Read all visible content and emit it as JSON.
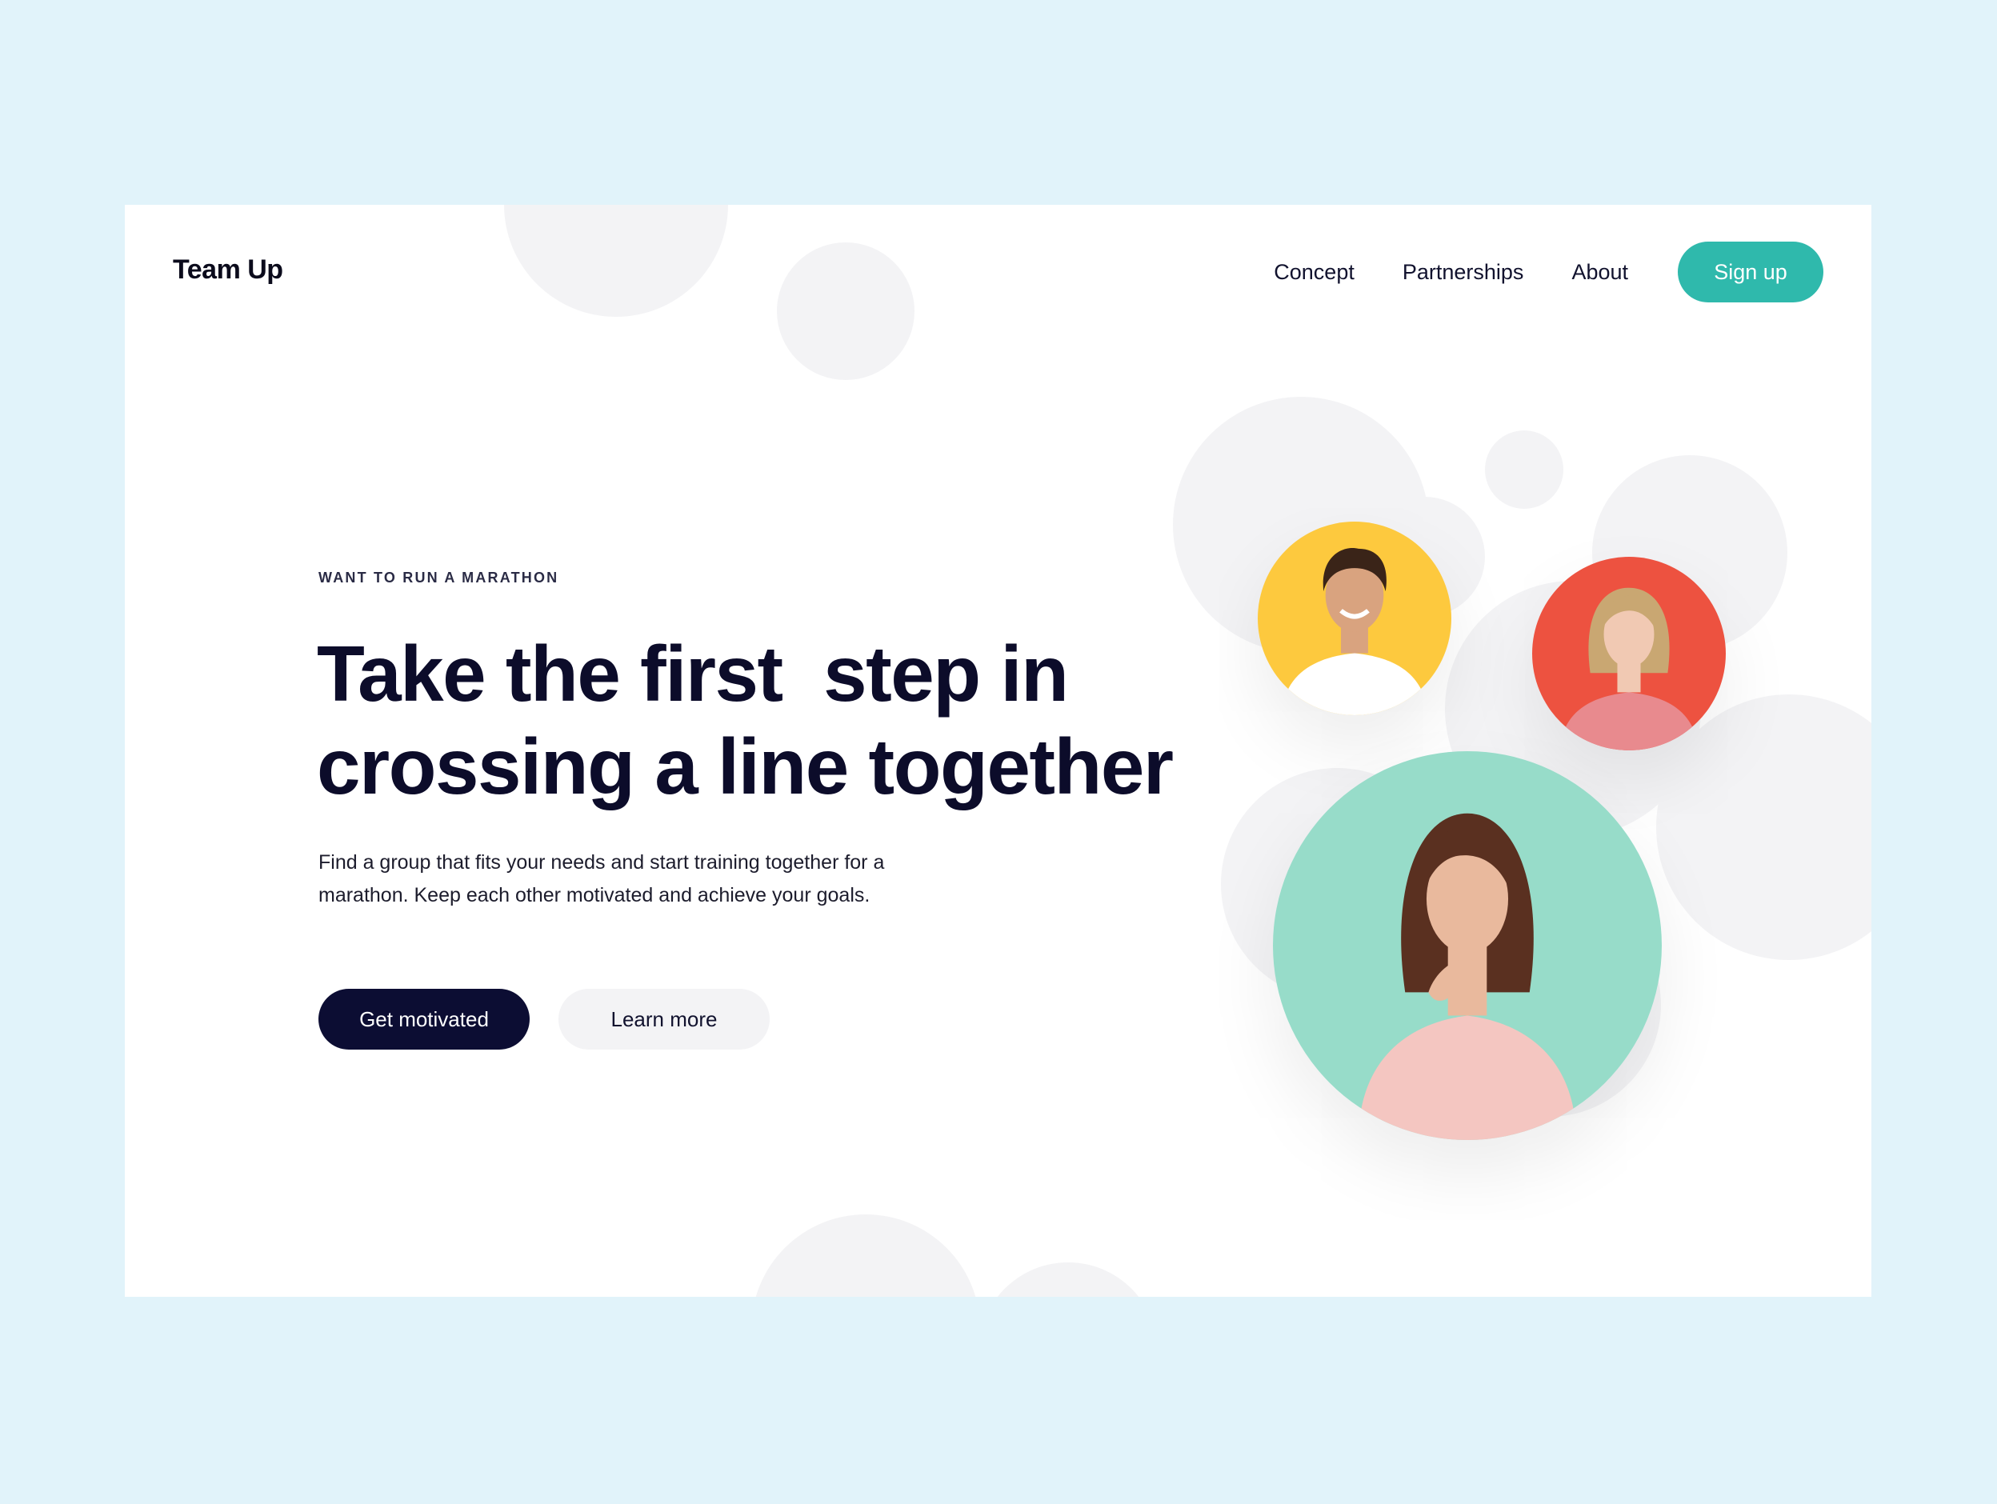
{
  "header": {
    "logo": "Team Up",
    "nav": [
      "Concept",
      "Partnerships",
      "About"
    ],
    "signup_label": "Sign up"
  },
  "hero": {
    "eyebrow": "WANT TO RUN A MARATHON",
    "headline_lines": [
      "Take the first  step in",
      "crossing a line together"
    ],
    "description_lines": [
      "Find a group that fits your needs and start training together for a",
      "marathon. Keep each other motivated and achieve your goals."
    ],
    "primary_cta": "Get motivated",
    "secondary_cta": "Learn more"
  },
  "avatars": [
    {
      "name": "man-avatar",
      "bg": "#fdc93e",
      "shirt": "#ffffff",
      "hair": "#3a2418",
      "skin": "#d9a37f"
    },
    {
      "name": "blonde-woman-avatar",
      "bg": "#ed5240",
      "shirt": "#e88a8e",
      "hair": "#c9a772",
      "skin": "#f1c9b3"
    },
    {
      "name": "brunette-woman-avatar",
      "bg": "#97dcc9",
      "shirt": "#f4c6c1",
      "hair": "#5a3020",
      "skin": "#e9b99d"
    }
  ],
  "colors": {
    "page_bg": "#e1f3fa",
    "accent": "#2fb9ac",
    "navy": "#0c0d33",
    "bubble": "#f3f3f5"
  }
}
